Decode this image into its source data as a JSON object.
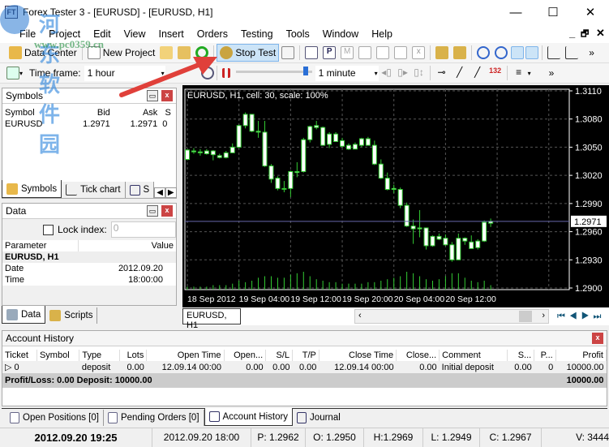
{
  "window": {
    "title": "Forex Tester 3 - [EURUSD] - [EURUSD, H1]",
    "app_icon": "FT",
    "minimize": "—",
    "maximize": "☐",
    "close": "✕"
  },
  "watermark": {
    "line1": "河东软件园",
    "line2": "www.pc0359.cn"
  },
  "menu": [
    "File",
    "Project",
    "Edit",
    "View",
    "Insert",
    "Orders",
    "Testing",
    "Tools",
    "Window",
    "Help"
  ],
  "mdi": {
    "minimize": "_",
    "restore": "🗗",
    "close": "✕"
  },
  "toolbar1": {
    "data_center": "Data Center",
    "new_project": "New Project",
    "stop_test": "Stop Test",
    "overflow": "»"
  },
  "toolbar2": {
    "timeframe_label": "Time frame:",
    "timeframe_value": "1 hour",
    "speed_value": "1 minute",
    "overflow": "»",
    "speed_level": 95
  },
  "symbols_panel": {
    "title": "Symbols",
    "columns": [
      "Symbol",
      "Bid",
      "Ask",
      "S"
    ],
    "rows": [
      [
        "EURUSD",
        "1.2971",
        "1.2971",
        "0"
      ]
    ],
    "tabs": [
      "Symbols",
      "Tick chart",
      "S"
    ]
  },
  "data_panel": {
    "title": "Data",
    "lock_label": "Lock index:",
    "lock_value": "0",
    "columns": [
      "Parameter",
      "Value"
    ],
    "group": "EURUSD, H1",
    "rows": [
      [
        "Date",
        "2012.09.20"
      ],
      [
        "Time",
        "18:00:00"
      ]
    ],
    "tabs": [
      "Data",
      "Scripts"
    ]
  },
  "chart": {
    "caption": "EURUSD, H1, cell: 30, scale: 100%",
    "tab": "EURUSD, H1",
    "current_price": "1.2971",
    "colors": {
      "bg": "#000000",
      "candle": "#33cc33",
      "grid": "#555555",
      "price_line": "#6666aa"
    }
  },
  "chart_data": {
    "type": "candlestick",
    "symbol": "EURUSD",
    "timeframe": "H1",
    "ylim": [
      1.29,
      1.311
    ],
    "y_ticks": [
      "1.3110",
      "1.3080",
      "1.3050",
      "1.3020",
      "1.2990",
      "1.2960",
      "1.2930",
      "1.2900"
    ],
    "x_ticks": [
      {
        "i": 0,
        "label": "18 Sep 2012"
      },
      {
        "i": 8,
        "label": "19 Sep 04:00"
      },
      {
        "i": 16,
        "label": "19 Sep 12:00"
      },
      {
        "i": 24,
        "label": "19 Sep 20:00"
      },
      {
        "i": 32,
        "label": "20 Sep 04:00"
      },
      {
        "i": 40,
        "label": "20 Sep 12:00"
      }
    ],
    "ohlc": [
      [
        1.3037,
        1.3048,
        1.3036,
        1.3047
      ],
      [
        1.3046,
        1.3049,
        1.3043,
        1.3045
      ],
      [
        1.3045,
        1.3048,
        1.3041,
        1.3044
      ],
      [
        1.3043,
        1.3048,
        1.3042,
        1.3046
      ],
      [
        1.3046,
        1.3047,
        1.3036,
        1.3042
      ],
      [
        1.3041,
        1.3043,
        1.3038,
        1.3039
      ],
      [
        1.3039,
        1.3046,
        1.3038,
        1.3044
      ],
      [
        1.3044,
        1.3054,
        1.3044,
        1.305
      ],
      [
        1.305,
        1.3074,
        1.3049,
        1.3073
      ],
      [
        1.3073,
        1.3087,
        1.307,
        1.3085
      ],
      [
        1.3085,
        1.3085,
        1.3066,
        1.3067
      ],
      [
        1.3066,
        1.3078,
        1.306,
        1.3067
      ],
      [
        1.3066,
        1.3078,
        1.3029,
        1.303
      ],
      [
        1.303,
        1.3032,
        1.3012,
        1.3016
      ],
      [
        1.3017,
        1.3019,
        1.3004,
        1.3006
      ],
      [
        1.3006,
        1.3014,
        1.3002,
        1.3006
      ],
      [
        1.3006,
        1.3025,
        1.2997,
        1.3024
      ],
      [
        1.3023,
        1.3034,
        1.3018,
        1.3024
      ],
      [
        1.3024,
        1.306,
        1.3023,
        1.3058
      ],
      [
        1.3058,
        1.3073,
        1.3055,
        1.3072
      ],
      [
        1.3071,
        1.3078,
        1.3069,
        1.3073
      ],
      [
        1.3071,
        1.3072,
        1.3052,
        1.3052
      ],
      [
        1.3053,
        1.3066,
        1.3049,
        1.3064
      ],
      [
        1.3064,
        1.3066,
        1.3056,
        1.3056
      ],
      [
        1.3057,
        1.306,
        1.305,
        1.3051
      ],
      [
        1.3052,
        1.3054,
        1.3047,
        1.3048
      ],
      [
        1.3048,
        1.3055,
        1.3048,
        1.3053
      ],
      [
        1.3052,
        1.306,
        1.305,
        1.3059
      ],
      [
        1.3059,
        1.3061,
        1.3052,
        1.3052
      ],
      [
        1.3052,
        1.3057,
        1.3031,
        1.3032
      ],
      [
        1.3032,
        1.3037,
        1.3016,
        1.3017
      ],
      [
        1.3017,
        1.3023,
        1.3004,
        1.3005
      ],
      [
        1.3006,
        1.301,
        1.3001,
        1.3005
      ],
      [
        1.3005,
        1.3007,
        1.2985,
        1.2988
      ],
      [
        1.2988,
        1.2991,
        1.2965,
        1.2966
      ],
      [
        1.2966,
        1.2973,
        1.2947,
        1.2963
      ],
      [
        1.2963,
        1.2983,
        1.2954,
        1.2964
      ],
      [
        1.2964,
        1.2964,
        1.2941,
        1.2945
      ],
      [
        1.2945,
        1.2956,
        1.2944,
        1.2955
      ],
      [
        1.2955,
        1.2958,
        1.2951,
        1.2952
      ],
      [
        1.2953,
        1.2957,
        1.2945,
        1.2946
      ],
      [
        1.2946,
        1.2949,
        1.2928,
        1.293
      ],
      [
        1.293,
        1.2958,
        1.293,
        1.2953
      ],
      [
        1.2953,
        1.2954,
        1.2946,
        1.295
      ],
      [
        1.2949,
        1.2956,
        1.2943,
        1.2942
      ],
      [
        1.2943,
        1.2952,
        1.2941,
        1.295
      ],
      [
        1.295,
        1.2972,
        1.2949,
        1.297
      ],
      [
        1.2969,
        1.2974,
        1.2965,
        1.2971
      ]
    ],
    "volume_rel": [
      2,
      2,
      2,
      2,
      3,
      3,
      3,
      4,
      6,
      5,
      6,
      8,
      9,
      9,
      8,
      8,
      10,
      11,
      12,
      9,
      7,
      6,
      5,
      5,
      4,
      4,
      4,
      4,
      5,
      5,
      6,
      7,
      8,
      9,
      12,
      11,
      9,
      7,
      6,
      7,
      9,
      11,
      11,
      8,
      6,
      5,
      6,
      3
    ],
    "current_price": 1.2971
  },
  "account_history": {
    "title": "Account History",
    "columns": [
      "Ticket",
      "Symbol",
      "Type",
      "Lots",
      "Open Time",
      "Open...",
      "S/L",
      "T/P",
      "Close Time",
      "Close...",
      "Comment",
      "S...",
      "P...",
      "Profit"
    ],
    "rows": [
      [
        "0",
        "",
        "deposit",
        "0.00",
        "12.09.14 00:00",
        "0.00",
        "0.00",
        "0.00",
        "12.09.14 00:00",
        "0.00",
        "Initial deposit",
        "0.00",
        "0",
        "10000.00"
      ]
    ],
    "summary": "Profit/Loss: 0.00 Deposit: 10000.00",
    "summary_total": "10000.00"
  },
  "bottom_tabs": [
    "Open Positions [0]",
    "Pending Orders [0]",
    "Account History",
    "Journal"
  ],
  "status": [
    "2012.09.20 19:25",
    "2012.09.20 18:00",
    "P: 1.2962",
    "O: 1.2950",
    "H:1.2969",
    "L: 1.2949",
    "C: 1.2967",
    "V: 3444"
  ]
}
